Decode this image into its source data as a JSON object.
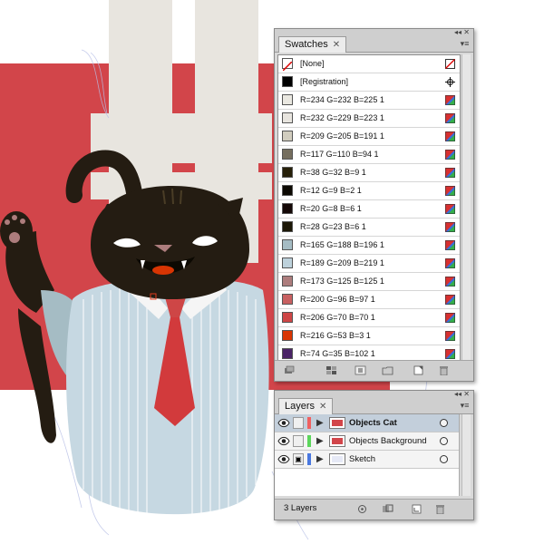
{
  "swatches_panel": {
    "tab_label": "Swatches",
    "tab_close": "✕",
    "top_controls": "◂◂  ✕",
    "menu_icon": "options-menu-icon",
    "items": [
      {
        "label": "[None]",
        "kind": "none",
        "color": "#ffffff"
      },
      {
        "label": "[Registration]",
        "kind": "registration",
        "color": "#000000"
      },
      {
        "label": "R=234 G=232 B=225 1",
        "kind": "color",
        "color": "#eae8e1"
      },
      {
        "label": "R=232 G=229 B=223 1",
        "kind": "color",
        "color": "#e8e5df"
      },
      {
        "label": "R=209 G=205 B=191 1",
        "kind": "color",
        "color": "#d1cdbf"
      },
      {
        "label": "R=117 G=110 B=94 1",
        "kind": "color",
        "color": "#756e5e"
      },
      {
        "label": "R=38 G=32 B=9 1",
        "kind": "color",
        "color": "#262009"
      },
      {
        "label": "R=12 G=9 B=2 1",
        "kind": "color",
        "color": "#0c0902"
      },
      {
        "label": "R=20 G=8 B=6 1",
        "kind": "color",
        "color": "#140806"
      },
      {
        "label": "R=28 G=23 B=6 1",
        "kind": "color",
        "color": "#1c1706"
      },
      {
        "label": "R=165 G=188 B=196 1",
        "kind": "color",
        "color": "#a5bcc4"
      },
      {
        "label": "R=189 G=209 B=219 1",
        "kind": "color",
        "color": "#bdd1db"
      },
      {
        "label": "R=173 G=125 B=125 1",
        "kind": "color",
        "color": "#ad7d7d"
      },
      {
        "label": "R=200 G=96 B=97 1",
        "kind": "color",
        "color": "#c86061"
      },
      {
        "label": "R=206 G=70 B=70 1",
        "kind": "color",
        "color": "#ce4646"
      },
      {
        "label": "R=216 G=53 B=3 1",
        "kind": "color",
        "color": "#d83503"
      },
      {
        "label": "R=74 G=35 B=102 1",
        "kind": "color",
        "color": "#4a2366"
      }
    ],
    "bottom_icons": [
      "swatch-libraries-icon",
      "show-kinds-icon",
      "swatch-options-icon",
      "new-color-group-icon",
      "new-swatch-icon",
      "delete-swatch-icon"
    ]
  },
  "layers_panel": {
    "tab_label": "Layers",
    "tab_close": "✕",
    "top_controls": "◂◂  ✕",
    "layers": [
      {
        "name": "Objects Cat",
        "color": "#f06060",
        "selected": true,
        "locked": false
      },
      {
        "name": "Objects Background",
        "color": "#5cd65c",
        "selected": false,
        "locked": false
      },
      {
        "name": "Sketch",
        "color": "#4a78e0",
        "selected": false,
        "locked": true
      }
    ],
    "status": "3 Layers",
    "bottom_icons": [
      "locate-object-icon",
      "make-clipping-mask-icon",
      "new-sublayer-icon",
      "new-layer-icon",
      "delete-layer-icon"
    ]
  },
  "colors": {
    "red_bg": "#d2454a",
    "cross": "#e8e5df",
    "fur": "#241c12",
    "shirt": "#c6d8e2",
    "tie": "#d23a3c"
  }
}
